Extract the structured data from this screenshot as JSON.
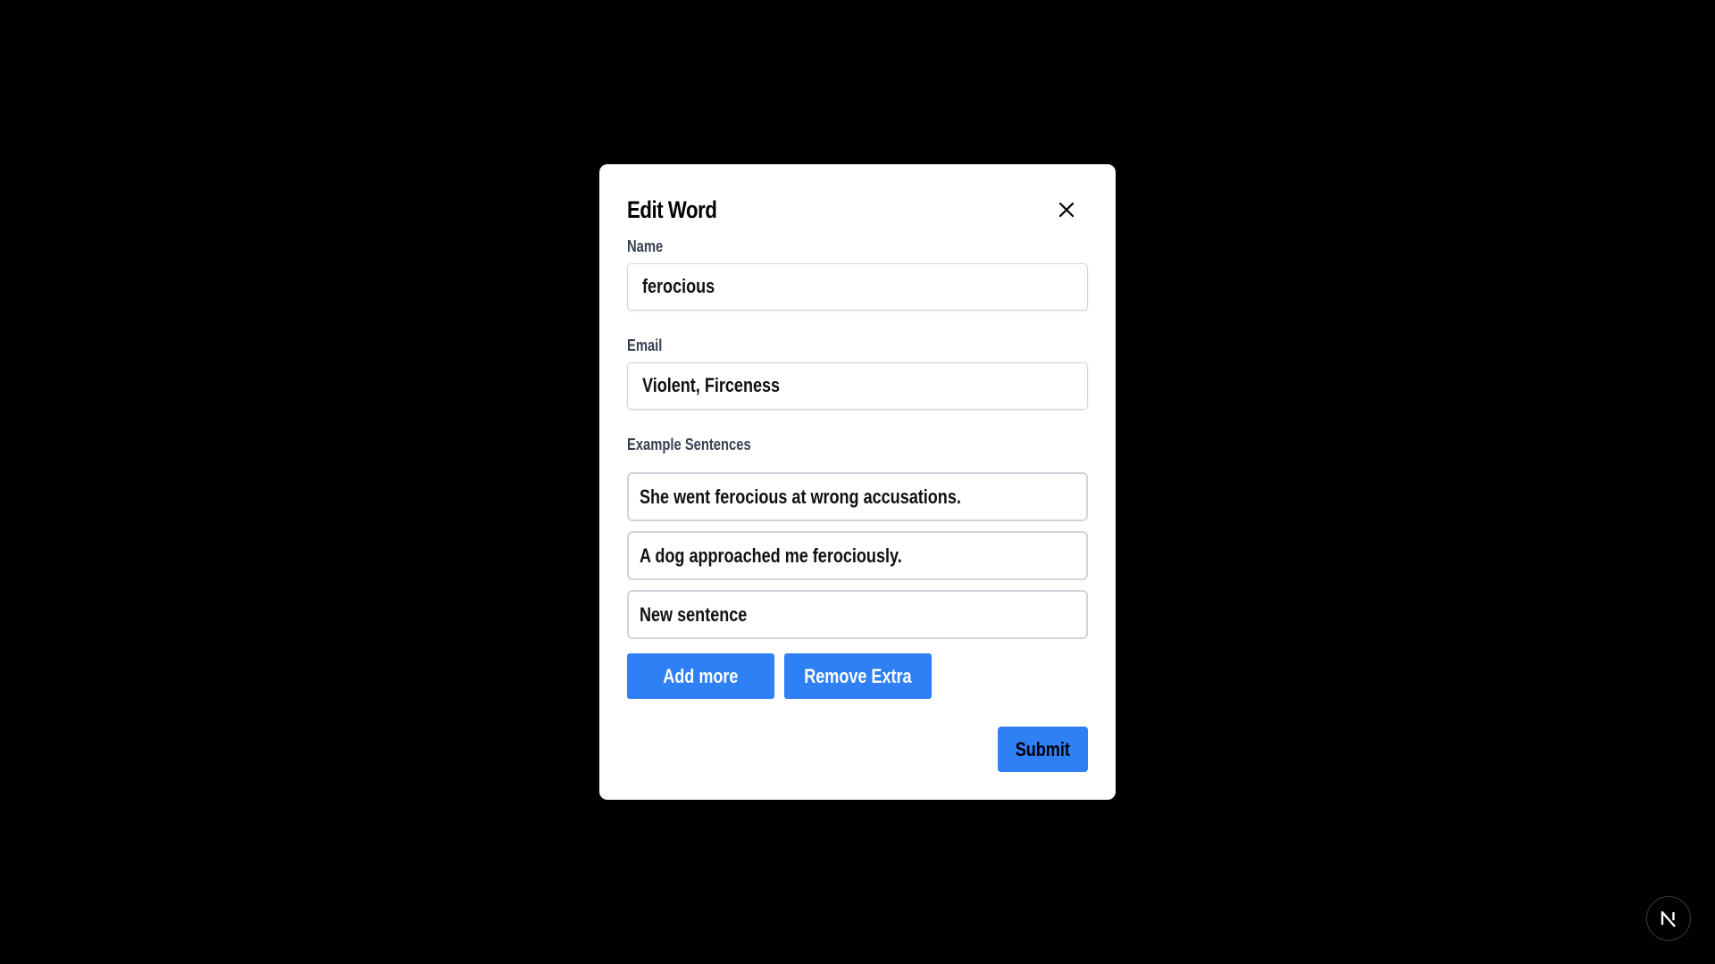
{
  "modal": {
    "title": "Edit Word",
    "close_icon": "close-icon"
  },
  "form": {
    "name": {
      "label": "Name",
      "value": "ferocious"
    },
    "email": {
      "label": "Email",
      "value": "Violent, Firceness"
    },
    "sentences": {
      "label": "Example Sentences",
      "items": [
        "She went ferocious at wrong accusations.",
        "A dog approached me ferociously.",
        "New sentence"
      ]
    }
  },
  "actions": {
    "add_more_label": "Add more",
    "remove_extra_label": "Remove Extra",
    "submit_label": "Submit"
  },
  "colors": {
    "accent": "#2f7ff5",
    "background": "#000000",
    "modal_bg": "#ffffff",
    "label": "#374151",
    "border": "#d1d5db"
  },
  "dev_indicator": {
    "icon": "nextjs-logo-icon"
  }
}
